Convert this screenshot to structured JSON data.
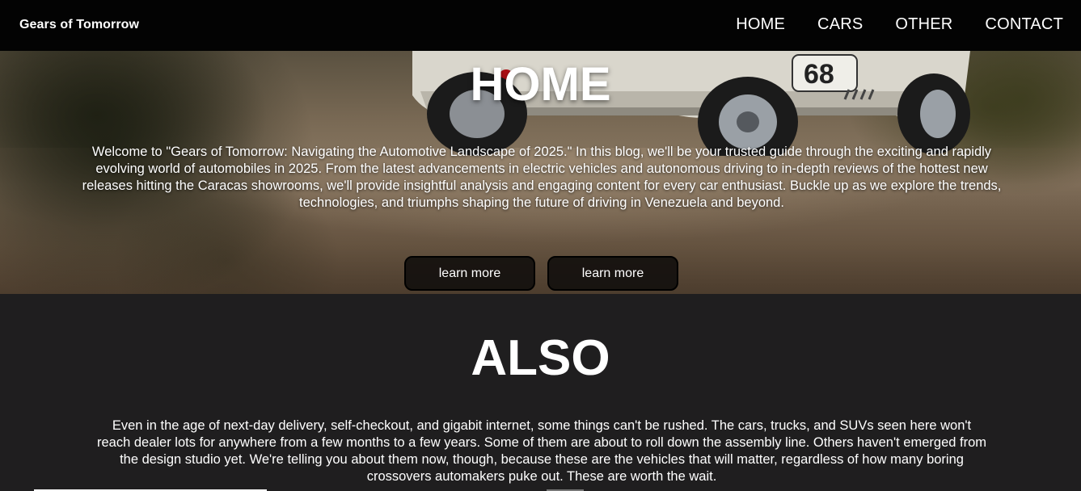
{
  "navbar": {
    "brand": "Gears of Tomorrow",
    "links": [
      "HOME",
      "CARS",
      "OTHER",
      "CONTACT"
    ]
  },
  "hero": {
    "title": "HOME",
    "text": "Welcome to \"Gears of Tomorrow: Navigating the Automotive Landscape of 2025.\" In this blog, we'll be your trusted guide through the exciting and rapidly evolving world of automobiles in 2025. From the latest advancements in electric vehicles and autonomous driving to in-depth reviews of the hottest new releases hitting the Caracas showrooms, we'll provide insightful analysis and engaging content for every car enthusiast. Buckle up as we explore the trends, technologies, and triumphs shaping the future of driving in Venezuela and beyond.",
    "buttons": [
      "learn more",
      "learn more"
    ],
    "background_image": "white vintage race car on desert road"
  },
  "also": {
    "title": "ALSO",
    "text": "Even in the age of next-day delivery, self-checkout, and gigabit internet, some things can't be rushed. The cars, trucks, and SUVs seen here won't reach dealer lots for anywhere from a few months to a few years. Some of them are about to roll down the assembly line. Others haven't emerged from the design studio yet. We're telling you about them now, though, because these are the vehicles that will matter, regardless of how many boring crossovers automakers puke out. These are worth the wait."
  },
  "colors": {
    "navbar_bg": "#030303",
    "section_bg": "#1f1e1f",
    "button_bg": "#14100e",
    "text": "#ffffff"
  }
}
